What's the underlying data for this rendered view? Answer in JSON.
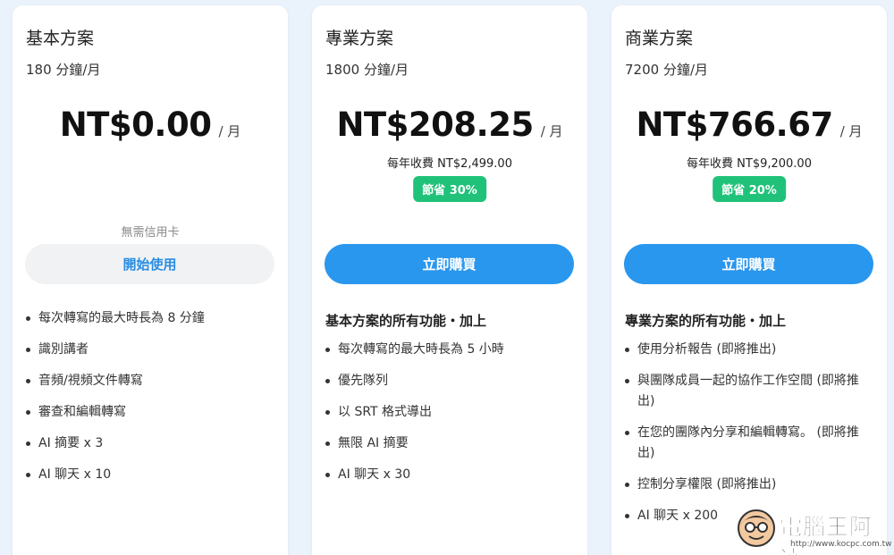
{
  "plans": [
    {
      "name": "基本方案",
      "minutes": "180 分鐘/月",
      "price": "NT$0.00",
      "per": "/ 月",
      "no_card": "無需信用卡",
      "button": "開始使用",
      "features": [
        "每次轉寫的最大時長為 8 分鐘",
        "識別講者",
        "音頻/視頻文件轉寫",
        "審查和編輯轉寫",
        "AI 摘要 x 3",
        "AI 聊天 x 10"
      ]
    },
    {
      "name": "專業方案",
      "minutes": "1800 分鐘/月",
      "price": "NT$208.25",
      "per": "/ 月",
      "annual": "每年收費 NT$2,499.00",
      "save": "節省 30%",
      "button": "立即購買",
      "features_heading": "基本方案的所有功能・加上",
      "features": [
        "每次轉寫的最大時長為 5 小時",
        "優先隊列",
        "以 SRT 格式導出",
        "無限 AI 摘要",
        "AI 聊天 x 30"
      ]
    },
    {
      "name": "商業方案",
      "minutes": "7200 分鐘/月",
      "price": "NT$766.67",
      "per": "/ 月",
      "annual": "每年收費 NT$9,200.00",
      "save": "節省 20%",
      "button": "立即購買",
      "features_heading": "專業方案的所有功能・加上",
      "features": [
        "使用分析報告 (即將推出)",
        "與團隊成員一起的協作工作空間 (即將推出)",
        "在您的團隊內分享和編輯轉寫。 (即將推出)",
        "控制分享權限 (即將推出)",
        "AI 聊天 x 200"
      ]
    }
  ],
  "watermark": {
    "name": "電腦王阿達",
    "url": "http://www.kocpc.com.tw",
    "icon": "mascot-face-icon"
  },
  "colors": {
    "accent": "#2a97ee",
    "badge": "#20c27a",
    "background": "#eaf2fb"
  }
}
